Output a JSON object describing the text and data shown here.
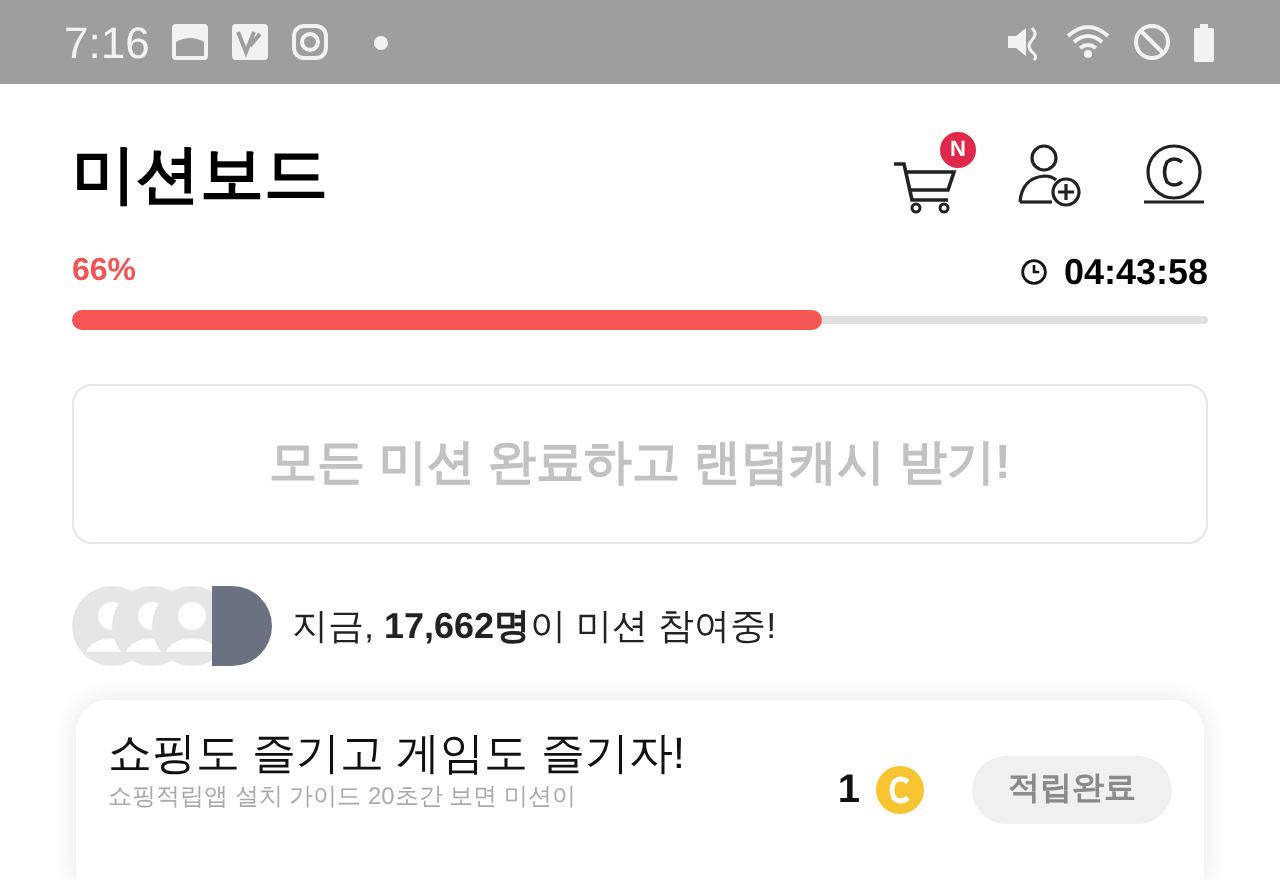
{
  "status_bar": {
    "time": "7:16"
  },
  "header": {
    "title": "미션보드",
    "cart_badge": "N"
  },
  "progress": {
    "percent": "66%",
    "timer": "04:43:58",
    "level": 0.66
  },
  "reward_button": {
    "label": "모든 미션 완료하고 랜덤캐시 받기!",
    "disabled": true
  },
  "participants": {
    "text": "지금, **17,662명**이 미션 참여중!"
  },
  "mission_card": {
    "title": "쇼핑도 즐기고 게임도 즐기자!",
    "description": "쇼핑적립앱 설치 가이드 20초간 보면 미션이",
    "reward": "1",
    "button": "적립완료",
    "completed": true
  }
}
